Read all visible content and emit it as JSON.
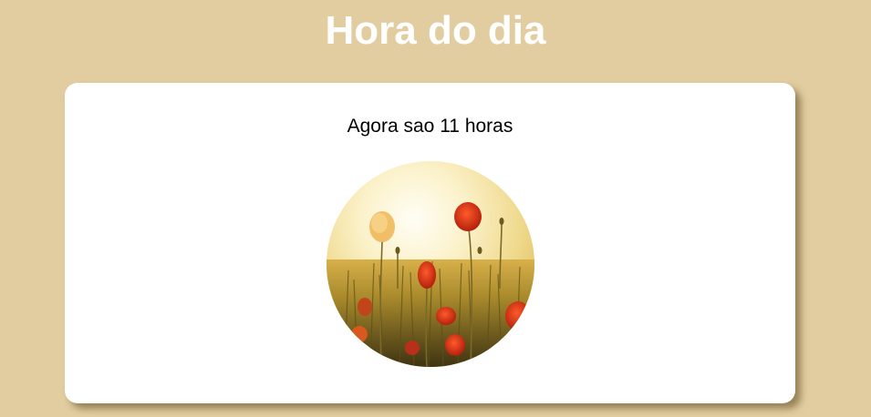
{
  "header": {
    "title": "Hora do dia"
  },
  "card": {
    "message": "Agora sao 11 horas"
  },
  "photo": {
    "subject": "poppy field at sunrise"
  },
  "colors": {
    "background": "#e1cd9f",
    "card": "#ffffff",
    "title": "#ffffff"
  }
}
